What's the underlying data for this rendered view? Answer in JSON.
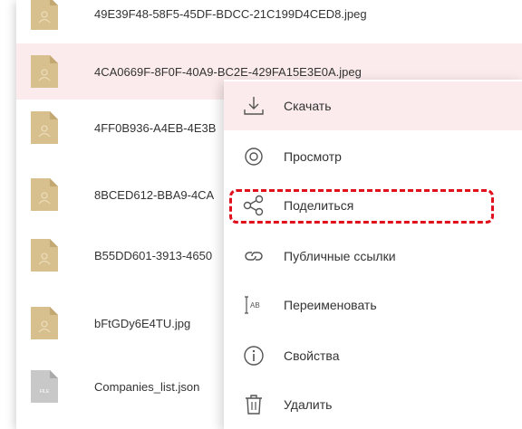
{
  "files": [
    {
      "name": "49E39F48-58F5-45DF-BDCC-21C199D4CED8.jpeg",
      "type": "image"
    },
    {
      "name": "4CA0669F-8F0F-40A9-BC2E-429FA15E3E0A.jpeg",
      "type": "image",
      "selected": true
    },
    {
      "name": "4FF0B936-A4EB-4E3B",
      "type": "image"
    },
    {
      "name": "8BCED612-BBA9-4CA",
      "type": "image"
    },
    {
      "name": "B55DD601-3913-4650",
      "type": "image"
    },
    {
      "name": "bFtGDy6E4TU.jpg",
      "type": "image"
    },
    {
      "name": "Companies_list.json",
      "type": "file",
      "badge": "FILE"
    }
  ],
  "menu": {
    "items": [
      {
        "label": "Скачать",
        "icon": "download-icon"
      },
      {
        "label": "Просмотр",
        "icon": "eye-icon"
      },
      {
        "label": "Поделиться",
        "icon": "share-icon"
      },
      {
        "label": "Публичные ссылки",
        "icon": "link-icon"
      },
      {
        "label": "Переименовать",
        "icon": "rename-icon",
        "icon_text": "AB"
      },
      {
        "label": "Свойства",
        "icon": "info-icon"
      },
      {
        "label": "Удалить",
        "icon": "trash-icon"
      }
    ]
  },
  "colors": {
    "folder_tan": "#d8bf8e",
    "highlight": "#fbebec",
    "annotation": "#e0101c",
    "icon_gray": "#555555"
  }
}
